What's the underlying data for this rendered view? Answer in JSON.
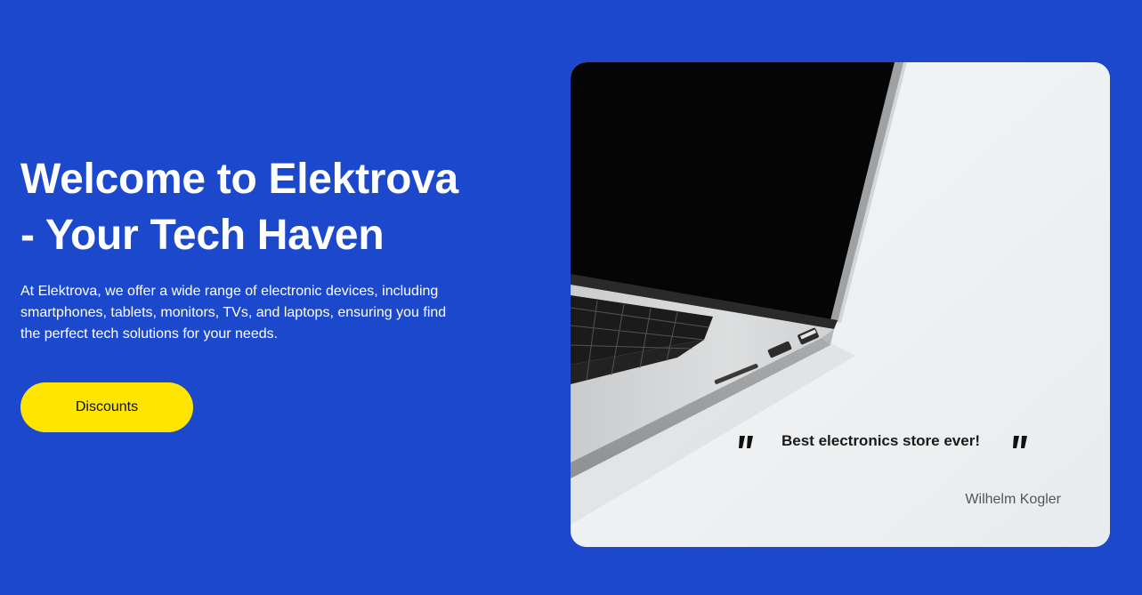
{
  "hero": {
    "title_line1": "Welcome to Elektrova",
    "title_line2": "- Your Tech Haven",
    "description": "At Elektrova, we offer a wide range of electronic devices, including smartphones, tablets, monitors, TVs, and laptops, ensuring you find the perfect tech solutions for your needs.",
    "cta_label": "Discounts"
  },
  "testimonial": {
    "quote": "Best electronics store ever!",
    "author": "Wilhelm Kogler"
  },
  "colors": {
    "background": "#1c48cc",
    "cta": "#ffe600",
    "text_light": "#ffffff",
    "card_bg": "#eef0f2"
  },
  "icons": {
    "open_quote": "quote-open-icon",
    "close_quote": "quote-close-icon"
  }
}
